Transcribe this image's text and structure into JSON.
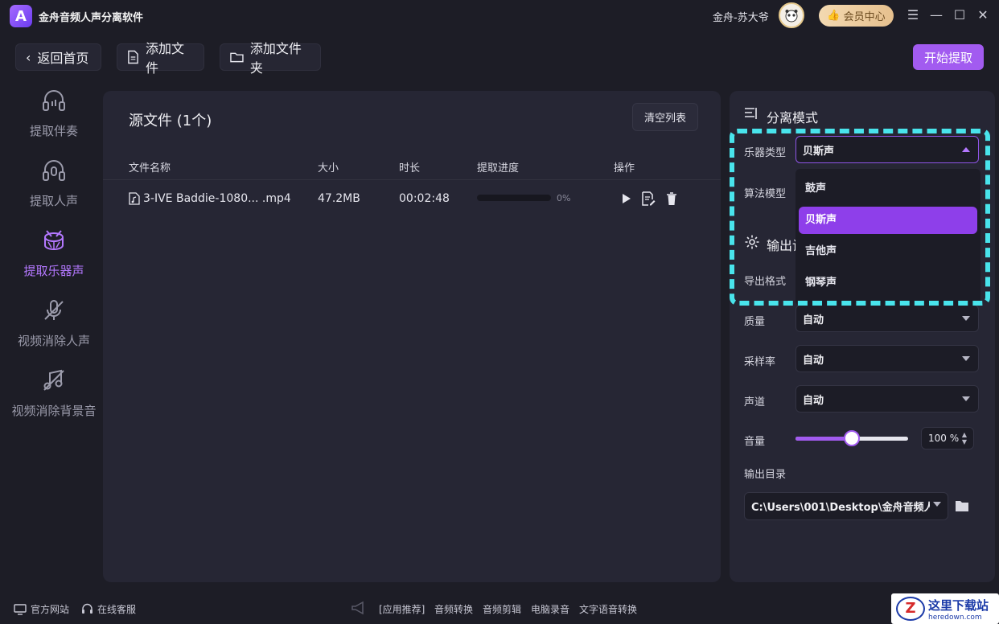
{
  "app": {
    "title": "金舟音频人声分离软件",
    "logo_letter": "A"
  },
  "user": {
    "name": "金舟-苏大爷",
    "vip_label": "会员中心"
  },
  "window": {
    "menu": "☰",
    "min": "—",
    "max": "☐",
    "close": "✕"
  },
  "toolbar": {
    "back_label": "返回首页",
    "add_file_label": "添加文件",
    "add_folder_label": "添加文件夹",
    "start_label": "开始提取"
  },
  "sidebar": {
    "items": [
      {
        "label": "提取伴奏",
        "icon": "headphone-icon",
        "active": false
      },
      {
        "label": "提取人声",
        "icon": "headphone-mic-icon",
        "active": false
      },
      {
        "label": "提取乐器声",
        "icon": "drum-icon",
        "active": true
      },
      {
        "label": "视频消除人声",
        "icon": "mic-off-icon",
        "active": false
      },
      {
        "label": "视频消除背景音",
        "icon": "music-off-icon",
        "active": false
      }
    ]
  },
  "main": {
    "title": "源文件 (1个)",
    "clear_label": "清空列表",
    "columns": [
      "文件名称",
      "大小",
      "时长",
      "提取进度",
      "操作"
    ],
    "rows": [
      {
        "name": "3-IVE Baddie-1080... .mp4",
        "size": "47.2MB",
        "duration": "00:02:48",
        "progress": 0,
        "progress_text": "0%"
      }
    ]
  },
  "settings": {
    "mode_title": "分离模式",
    "instrument_label": "乐器类型",
    "instrument_value": "贝斯声",
    "algorithm_label": "算法模型",
    "instrument_options": [
      "鼓声",
      "贝斯声",
      "吉他声",
      "钢琴声"
    ],
    "instrument_selected": "贝斯声",
    "output_title": "输出设置",
    "format_label": "导出格式",
    "quality_label": "质量",
    "quality_value": "自动",
    "samplerate_label": "采样率",
    "samplerate_value": "自动",
    "channel_label": "声道",
    "channel_value": "自动",
    "volume_label": "音量",
    "volume_value": "100 %",
    "volume_level": 0.5,
    "dir_label": "输出目录",
    "dir_value": "C:\\Users\\001\\Desktop\\金舟音频人"
  },
  "footer": {
    "website": "官方网站",
    "service": "在线客服",
    "recommend": "[应用推荐]",
    "links": [
      "音频转换",
      "音频剪辑",
      "电脑录音",
      "文字语音转换"
    ]
  },
  "watermark": {
    "text": "这里下载站",
    "sub": "heredown.com",
    "letter": "Z"
  },
  "colors": {
    "accent": "#a25bf0",
    "highlight": "#49e4ec",
    "bg": "#1d1d26",
    "panel": "#262634"
  }
}
